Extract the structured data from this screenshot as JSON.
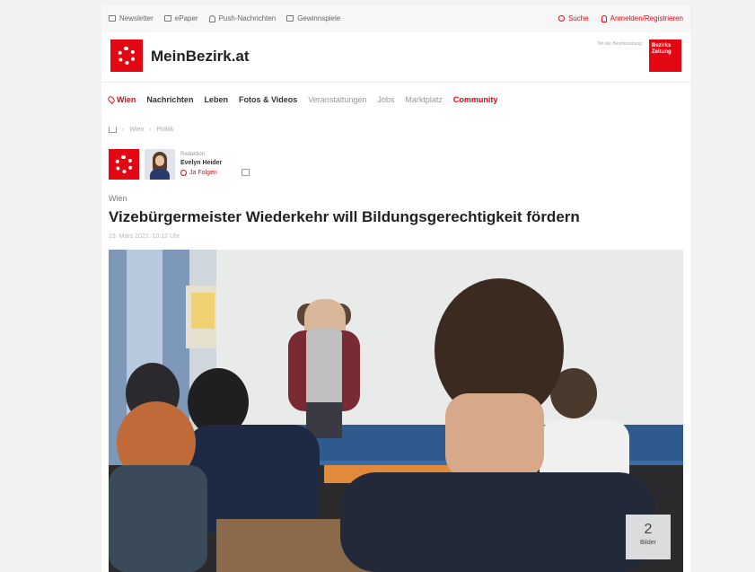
{
  "topbar": {
    "newsletter": "Newsletter",
    "epaper": "ePaper",
    "push": "Push-Nachrichten",
    "gewinnspiele": "Gewinnspiele",
    "search": "Suche",
    "login": "Anmelden/Registrieren"
  },
  "header": {
    "logo_text": "MeinBezirk.at",
    "note": "Teil der Bezirkszeitung",
    "bz_logo": "Bezirks Zeitung"
  },
  "nav": {
    "location": "Wien",
    "items": [
      "Nachrichten",
      "Leben",
      "Fotos & Videos",
      "Veranstaltungen",
      "Jobs",
      "Marktplatz",
      "Community"
    ]
  },
  "breadcrumb": [
    "Wien",
    "Politik"
  ],
  "author": {
    "role": "Redaktion",
    "name": "Evelyn Heider",
    "follow": "Ja Folgen"
  },
  "article": {
    "category": "Wien",
    "title": "Vizebürgermeister Wiederkehr will Bildungsgerechtigkeit fördern",
    "date": "23. März 2022, 10:12 Uhr",
    "image_count": "2",
    "image_count_label": "Bilder"
  },
  "colors": {
    "brand": "#e30613"
  }
}
